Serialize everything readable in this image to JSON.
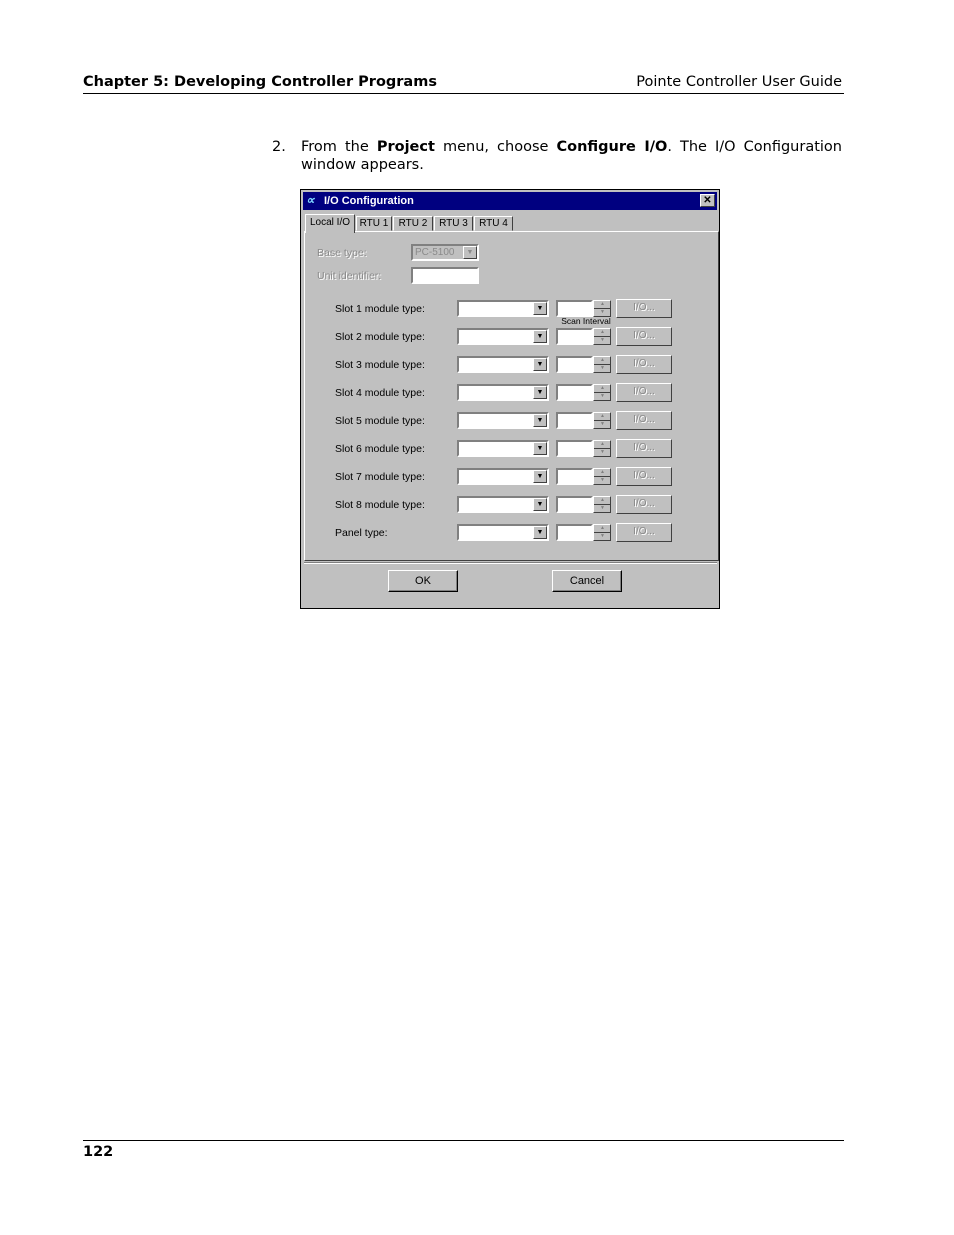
{
  "header": {
    "chapter": "Chapter 5: Developing Controller Programs",
    "guide": "Pointe Controller User Guide"
  },
  "step": {
    "number": "2.",
    "t1": "From the ",
    "b1": "Project",
    "t2": " menu, choose ",
    "b2": "Configure I/O",
    "t3": ". The I/O Configuration window appears."
  },
  "dialog": {
    "title": "I/O Configuration",
    "app_icon": "∝",
    "close_icon": "✕",
    "tabs": [
      "Local I/O",
      "RTU 1",
      "RTU 2",
      "RTU 3",
      "RTU 4"
    ],
    "base_type_label": "Base type:",
    "base_type_value": "PC-5100",
    "unit_identifier_label": "Unit identifier:",
    "scan_interval_header": "Scan Interval",
    "rows": [
      {
        "label": "Slot 1 module type:",
        "button": "I/O..."
      },
      {
        "label": "Slot 2 module type:",
        "button": "I/O..."
      },
      {
        "label": "Slot 3 module type:",
        "button": "I/O..."
      },
      {
        "label": "Slot 4 module type:",
        "button": "I/O..."
      },
      {
        "label": "Slot 5 module type:",
        "button": "I/O..."
      },
      {
        "label": "Slot 6 module type:",
        "button": "I/O..."
      },
      {
        "label": "Slot 7 module type:",
        "button": "I/O..."
      },
      {
        "label": "Slot 8 module type:",
        "button": "I/O..."
      },
      {
        "label": "Panel type:",
        "button": "I/O..."
      }
    ],
    "ok_label": "OK",
    "cancel_label": "Cancel"
  },
  "footer": {
    "page_number": "122"
  }
}
